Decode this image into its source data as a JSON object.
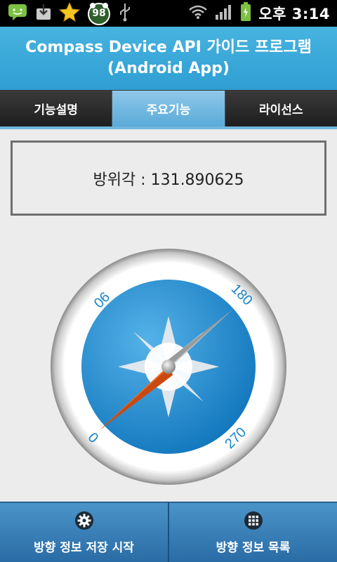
{
  "status_bar": {
    "icons": [
      "message-icon",
      "download-icon",
      "star-icon",
      "badge-icon",
      "usb-icon",
      "wifi-icon",
      "signal-icon",
      "battery-icon"
    ],
    "badge_count": "98",
    "time": "오후 3:14"
  },
  "header": {
    "title_line1": "Compass Device API 가이드 프로그램",
    "title_line2": "(Android App)"
  },
  "tabs": [
    {
      "label": "기능설명",
      "active": false
    },
    {
      "label": "주요기능",
      "active": true
    },
    {
      "label": "라이선스",
      "active": false
    }
  ],
  "azimuth": {
    "text": "방위각 : 131.890625"
  },
  "compass": {
    "labels": [
      "0",
      "90",
      "180",
      "270"
    ],
    "colors": {
      "dial": "#1f8fd1",
      "needle_north": "#e8581c",
      "needle_south": "#b9b9b9"
    }
  },
  "bottom": {
    "start_button": "방향 정보 저장 시작",
    "list_button": "방향 정보 목록"
  }
}
